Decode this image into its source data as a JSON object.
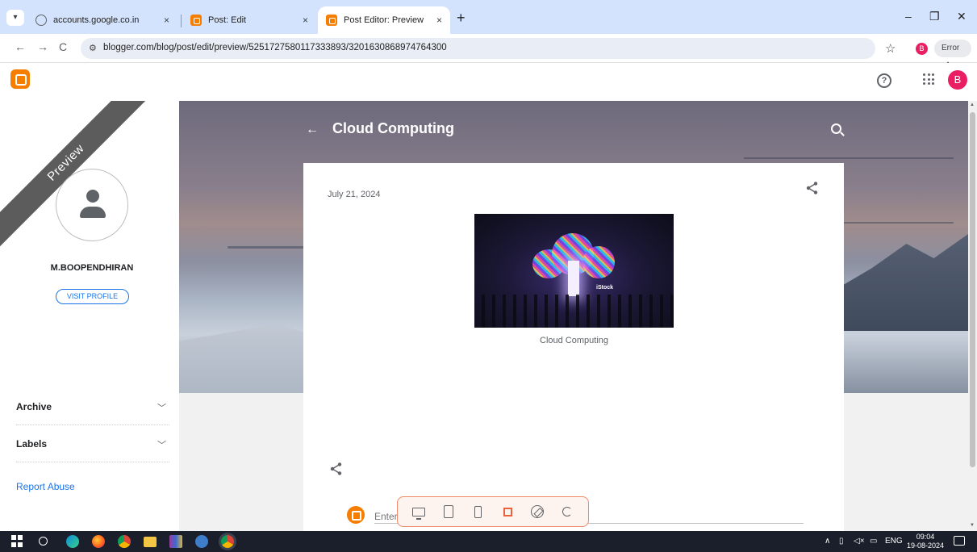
{
  "browser": {
    "tabs": [
      {
        "title": "accounts.google.co.in",
        "favicon": "globe-icon",
        "active": false
      },
      {
        "title": "Post: Edit",
        "favicon": "blogger-icon",
        "active": false
      },
      {
        "title": "Post Editor: Preview",
        "favicon": "blogger-icon",
        "active": true
      }
    ],
    "tab_close": "×",
    "new_tab": "+",
    "window_controls": {
      "minimize": "–",
      "restore": "❐",
      "close": "✕"
    },
    "url": "blogger.com/blog/post/edit/preview/5251727580117333893/3201630868974764300",
    "profile_initial": "B",
    "error_label": "Error",
    "colors": {
      "tabstrip": "#d3e3fd",
      "omnibox": "#e9eef6"
    }
  },
  "blogger_header": {
    "profile_initial": "B",
    "brand_color": "#f57d00",
    "profile_color": "#e91e63"
  },
  "sidebar": {
    "ribbon": "Preview",
    "profile_name": "M.BOOPENDHIRAN",
    "visit_profile": "VISIT PROFILE",
    "sections": [
      {
        "label": "Archive",
        "icon": "chevron-down-icon"
      },
      {
        "label": "Labels",
        "icon": "chevron-down-icon"
      }
    ],
    "report_abuse": "Report Abuse"
  },
  "post": {
    "blog_title": "Cloud Computing",
    "date": "July 21, 2024",
    "image_watermark": "iStock",
    "image_caption": "Cloud Computing",
    "comment_placeholder": "Enter"
  },
  "device_toolbar": {
    "items": [
      "desktop-icon",
      "tablet-icon",
      "phone-icon",
      "fullscreen-icon",
      "rotate-icon",
      "refresh-icon"
    ],
    "accent": "#e8603c"
  },
  "taskbar": {
    "language": "ENG",
    "time": "09:04",
    "date": "19-08-2024"
  }
}
